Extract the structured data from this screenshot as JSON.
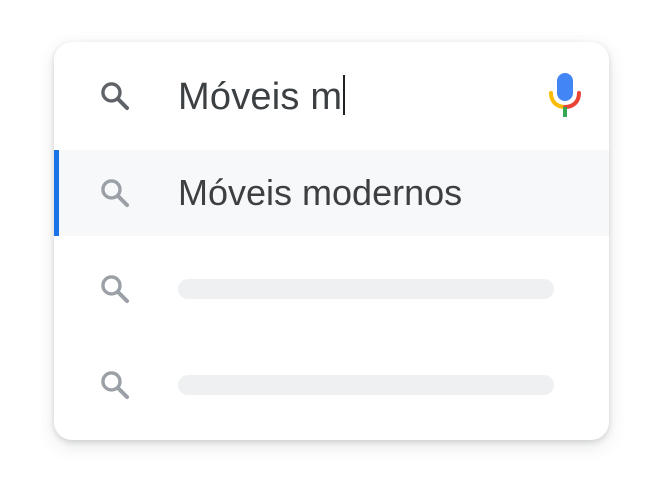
{
  "search": {
    "query": "Móveis m",
    "icon": "search-icon",
    "mic_icon": "microphone-icon"
  },
  "suggestions": [
    {
      "text": "Móveis modernos",
      "icon": "search-icon",
      "active": true
    },
    {
      "text": "",
      "icon": "search-icon",
      "placeholder": true
    },
    {
      "text": "",
      "icon": "search-icon",
      "placeholder": true
    }
  ],
  "colors": {
    "accent": "#1a73e8",
    "text": "#3c4043",
    "icon_dark": "#5f6368",
    "icon_light": "#9aa0a6",
    "placeholder": "#eef0f2",
    "active_row": "#f7f8f9",
    "mic_blue": "#4285f4",
    "mic_red": "#ea4335",
    "mic_yellow": "#fbbc05",
    "mic_green": "#34a853"
  }
}
